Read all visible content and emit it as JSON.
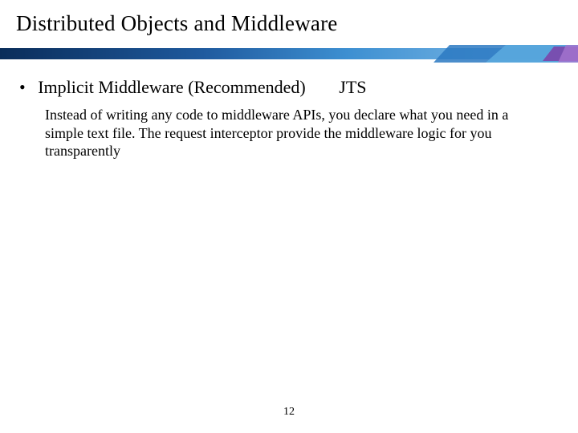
{
  "slide": {
    "title": "Distributed Objects and Middleware",
    "bullet": {
      "label": "Implicit Middleware (Recommended)",
      "aside": "JTS"
    },
    "body": "Instead of writing any code to middleware APIs, you declare what you need in a simple text file. The request interceptor provide the middleware logic for you transparently",
    "page_number": "12"
  },
  "colors": {
    "bar_dark": "#0a2d5a",
    "bar_mid": "#2b79c2",
    "bar_light": "#7fb6e6",
    "bar_accent": "#7e3fa8"
  }
}
